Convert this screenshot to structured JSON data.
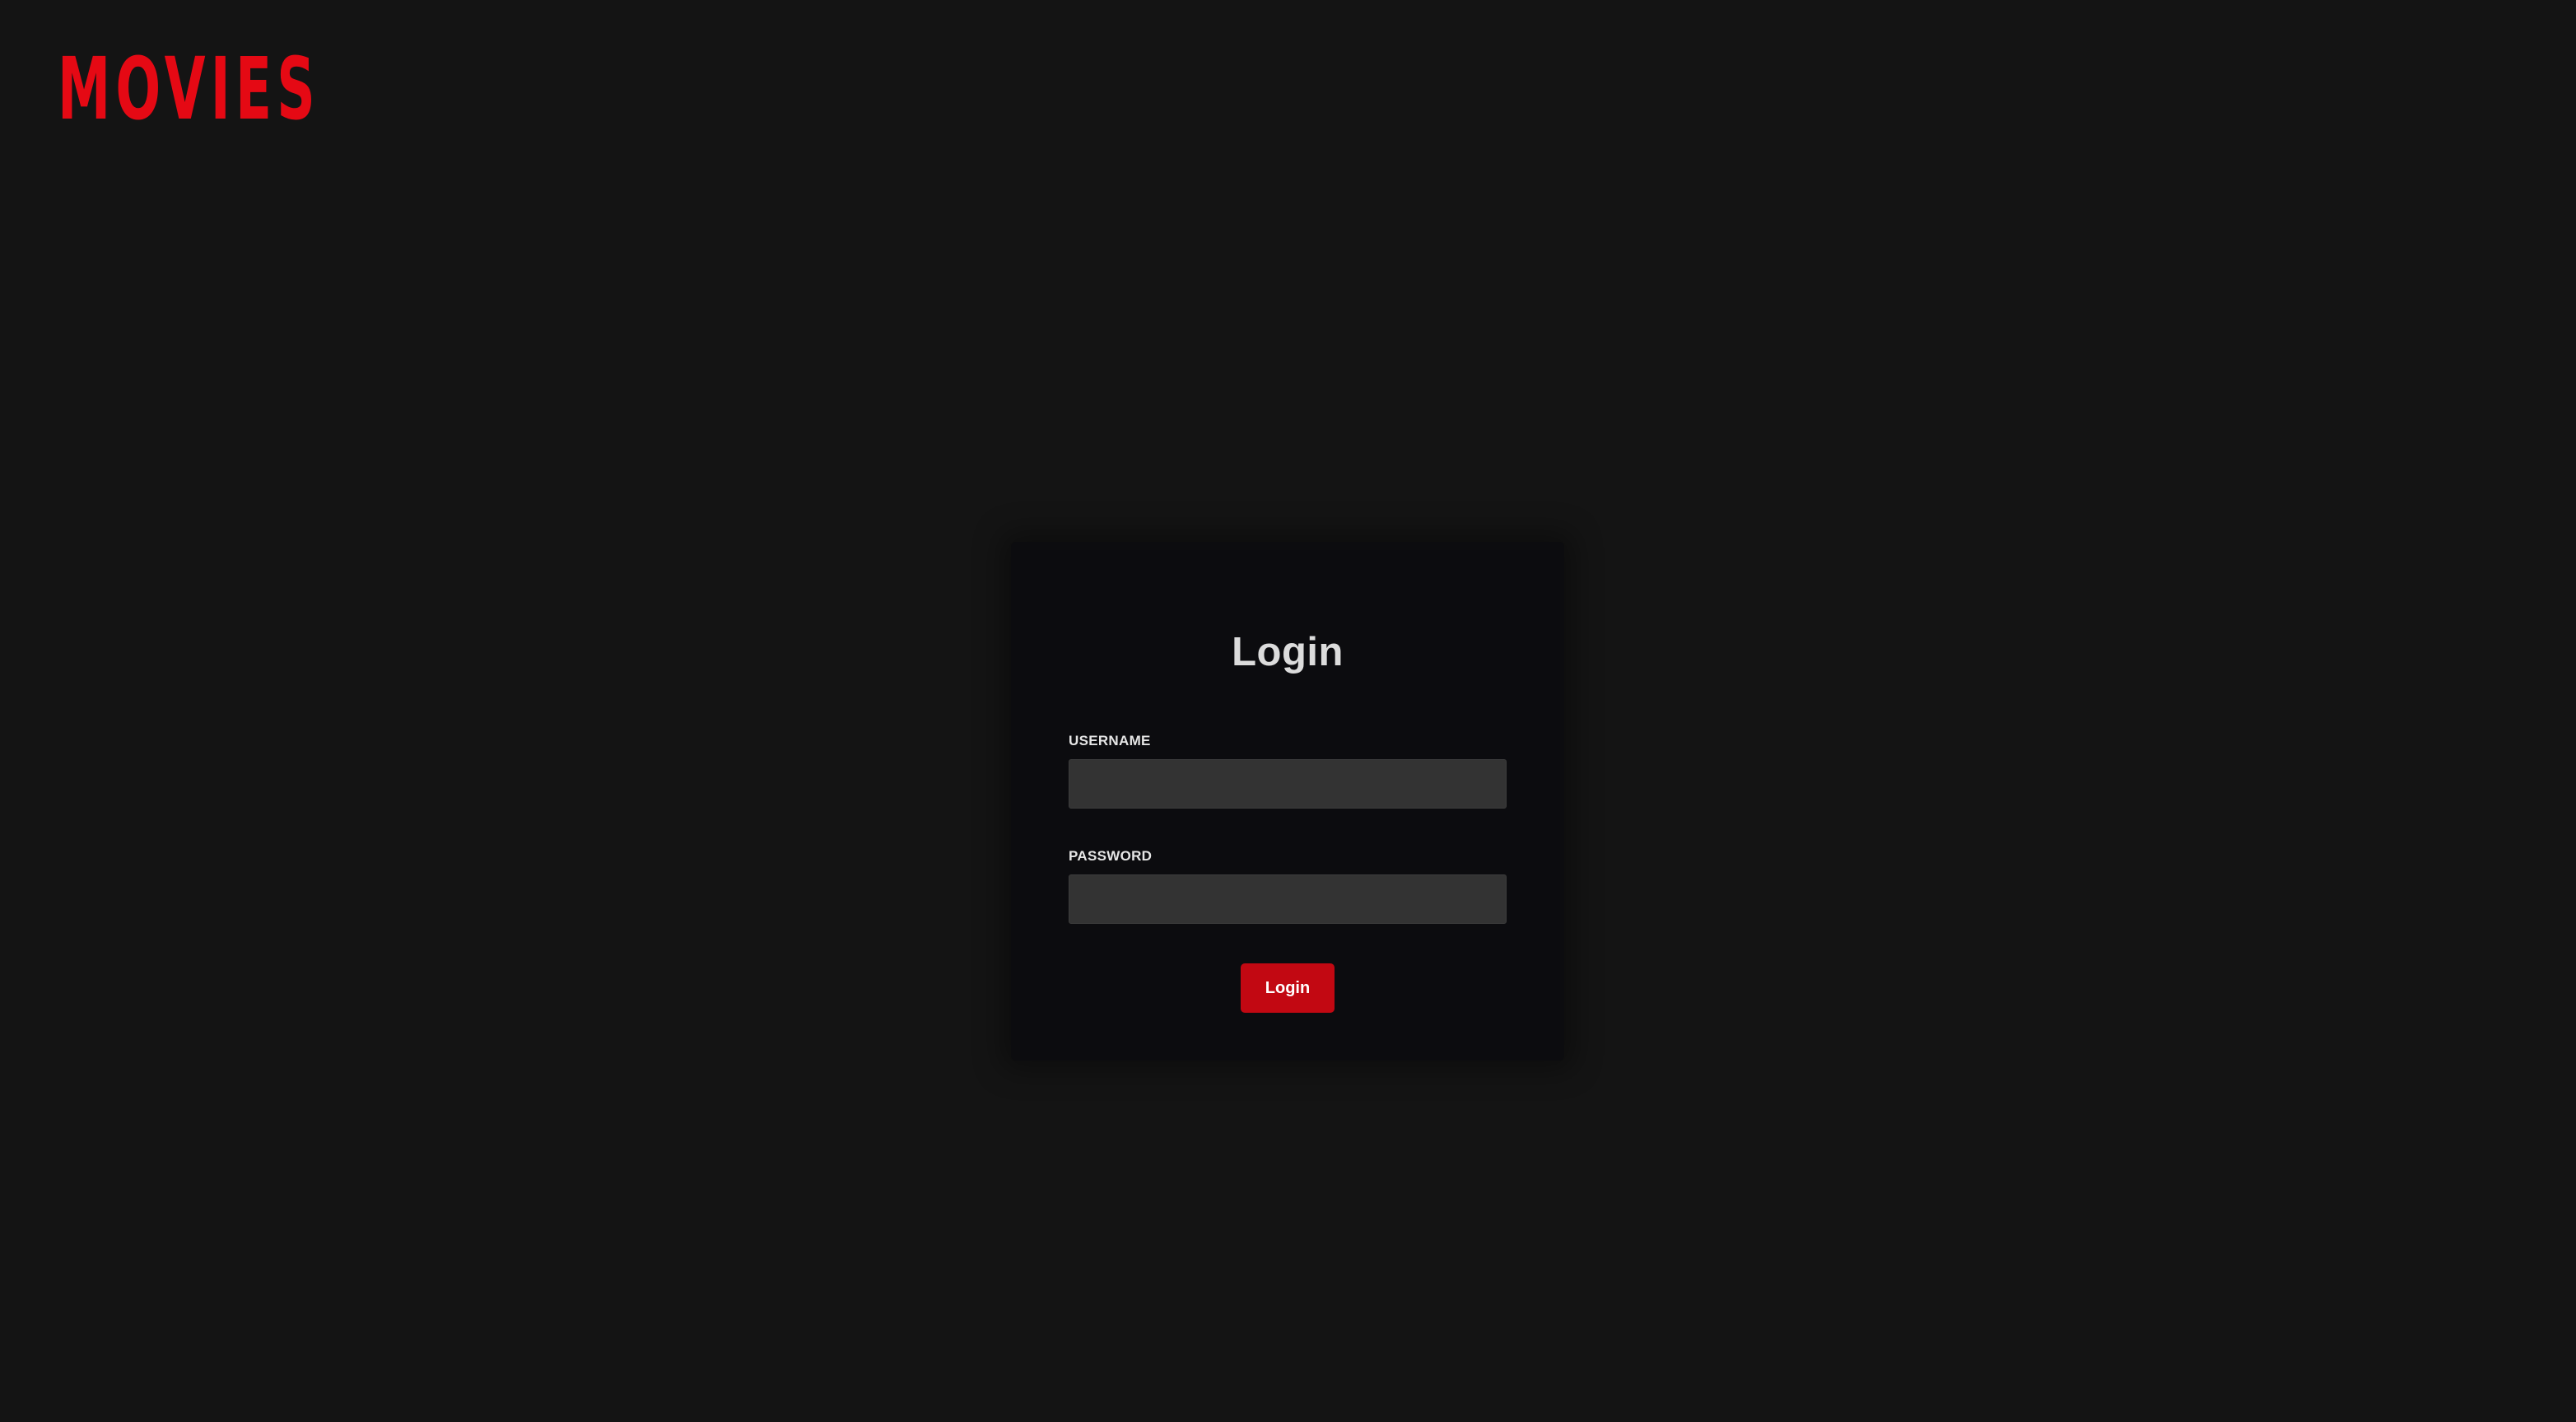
{
  "brand": {
    "logo_text": "MOVIES",
    "accent_color": "#e50914"
  },
  "login_form": {
    "title": "Login",
    "username": {
      "label": "USERNAME",
      "value": "",
      "placeholder": ""
    },
    "password": {
      "label": "PASSWORD",
      "value": "",
      "placeholder": ""
    },
    "submit_label": "Login",
    "button_color": "#c20812"
  }
}
